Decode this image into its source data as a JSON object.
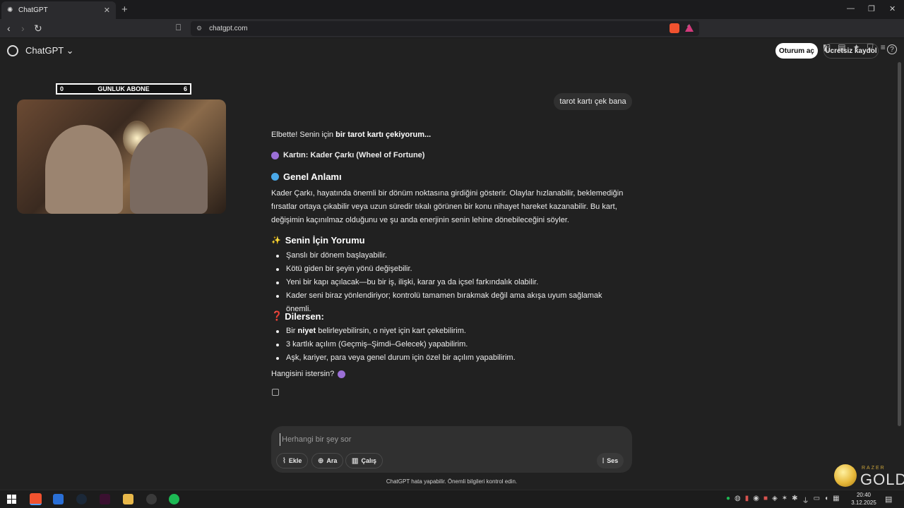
{
  "browser": {
    "tab_title": "ChatGPT",
    "tab_close": "✕",
    "new_tab": "+",
    "url": "chatgpt.com"
  },
  "header": {
    "title": "ChatGPT",
    "caret": "⌄",
    "login_label": "Oturum aç",
    "signup_label": "Ücretsiz kaydol",
    "help": "?"
  },
  "overlay": {
    "counter_left": "0",
    "counter_label": "GUNLUK ABONE",
    "counter_right": "6"
  },
  "chat": {
    "user_message": "tarot kartı çek bana",
    "intro_plain": "Elbette! Senin için ",
    "intro_bold": "bir tarot kartı çekiyorum...",
    "card_line": "Kartın: Kader Çarkı (Wheel of Fortune)",
    "section1_title": "Genel Anlamı",
    "section1_body": "Kader Çarkı, hayatında önemli bir dönüm noktasına girdiğini gösterir. Olaylar hızlanabilir, beklemediğin fırsatlar ortaya çıkabilir veya uzun süredir tıkalı görünen bir konu nihayet hareket kazanabilir. Bu kart, değişimin kaçınılmaz olduğunu ve şu anda enerjinin senin lehine dönebileceğini söyler.",
    "section2_title": "Senin İçin Yorumu",
    "section2_items": [
      "Şanslı bir dönem başlayabilir.",
      "Kötü giden bir şeyin yönü değişebilir.",
      "Yeni bir kapı açılacak—bu bir iş, ilişki, karar ya da içsel farkındalık olabilir.",
      "Kader seni biraz yönlendiriyor; kontrolü tamamen bırakmak değil ama akışa uyum sağlamak önemli."
    ],
    "section3_title": "Dilersen:",
    "section3_item1_pre": "Bir ",
    "section3_item1_bold": "niyet",
    "section3_item1_post": " belirleyebilirsin, o niyet için kart çekebilirim.",
    "section3_item2": "3 kartlık açılım (Geçmiş–Şimdi–Gelecek) yapabilirim.",
    "section3_item3": "Aşk, kariyer, para veya genel durum için özel bir açılım yapabilirim.",
    "closing": "Hangisini istersin?"
  },
  "composer": {
    "placeholder": "Herhangi bir şey sor",
    "attach_label": "Ekle",
    "search_label": "Ara",
    "study_label": "Çalış",
    "voice_label": "Ses",
    "disclaimer": "ChatGPT hata yapabilir. Önemli bilgileri kontrol edin."
  },
  "watermark": {
    "small": "RAZER",
    "big": "GOLD"
  },
  "taskbar": {
    "time": "20:40",
    "date": "3.12.2025"
  },
  "colors": {
    "background": "#212121",
    "bubble": "#303030",
    "brave": "#f0522f",
    "spotify": "#1db954",
    "razer_gold": "#e6b83a"
  },
  "icons": {
    "card_emoji": "crystal-ball-icon",
    "section1_emoji": "blue-dot-icon",
    "section2_emoji": "sparkles-icon",
    "section3_emoji": "question-mark-icon"
  }
}
